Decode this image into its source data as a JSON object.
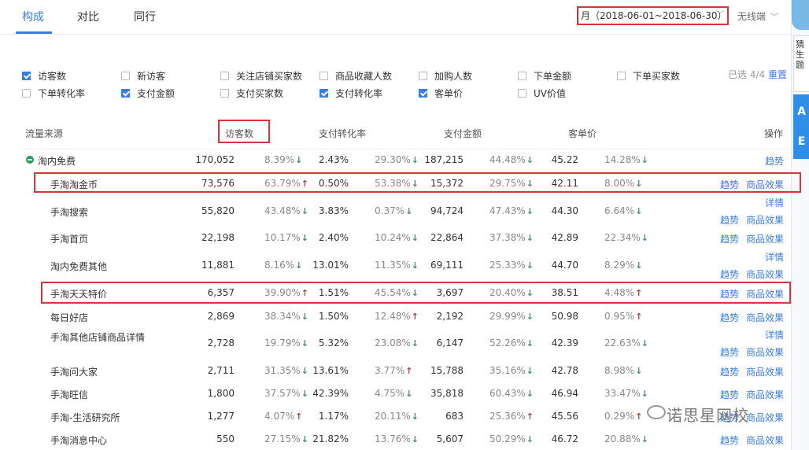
{
  "tabs": [
    {
      "label": "构成",
      "active": true
    },
    {
      "label": "对比",
      "active": false
    },
    {
      "label": "同行",
      "active": false
    }
  ],
  "date_range": "月（2018-06-01~2018-06-30）",
  "device": "无线端",
  "side_panel": {
    "tab_text": "猜生题",
    "blue1": "A",
    "blue2": "E"
  },
  "filters": [
    {
      "label": "访客数",
      "checked": true
    },
    {
      "label": "新访客",
      "checked": false
    },
    {
      "label": "关注店铺买家数",
      "checked": false
    },
    {
      "label": "商品收藏人数",
      "checked": false
    },
    {
      "label": "加购人数",
      "checked": false
    },
    {
      "label": "下单金额",
      "checked": false
    },
    {
      "label": "下单买家数",
      "checked": false
    },
    {
      "label": "下单转化率",
      "checked": false
    },
    {
      "label": "支付金额",
      "checked": true
    },
    {
      "label": "支付买家数",
      "checked": false
    },
    {
      "label": "支付转化率",
      "checked": true
    },
    {
      "label": "客单价",
      "checked": true
    },
    {
      "label": "UV价值",
      "checked": false
    }
  ],
  "selected_count": "已选 4/4",
  "reset": "重置",
  "columns": [
    "流量来源",
    "访客数",
    "支付转化率",
    "支付金额",
    "客单价",
    "操作"
  ],
  "rows": [
    {
      "source": "淘内免费",
      "top": true,
      "visitors": "170,052",
      "v_pct": "8.39%",
      "v_dir": "down",
      "conv": "2.43%",
      "c_pct": "29.30%",
      "c_dir": "down",
      "pay": "187,215",
      "p_pct": "44.48%",
      "p_dir": "down",
      "aov": "45.22",
      "a_pct": "14.28%",
      "a_dir": "down",
      "ops": [
        "趋势"
      ],
      "hl": false
    },
    {
      "source": "手淘淘金币",
      "top": false,
      "visitors": "73,576",
      "v_pct": "63.79%",
      "v_dir": "up",
      "conv": "0.50%",
      "c_pct": "53.38%",
      "c_dir": "down",
      "pay": "15,372",
      "p_pct": "29.75%",
      "p_dir": "down",
      "aov": "42.11",
      "a_pct": "8.00%",
      "a_dir": "down",
      "ops": [
        "趋势",
        "商品效果"
      ],
      "hl": true
    },
    {
      "source": "手淘搜索",
      "top": false,
      "visitors": "55,820",
      "v_pct": "43.48%",
      "v_dir": "down",
      "conv": "3.83%",
      "c_pct": "0.37%",
      "c_dir": "down",
      "pay": "94,724",
      "p_pct": "47.43%",
      "p_dir": "down",
      "aov": "44.30",
      "a_pct": "6.64%",
      "a_dir": "down",
      "ops": [
        "详情",
        "趋势",
        "商品效果"
      ],
      "hl": false
    },
    {
      "source": "手淘首页",
      "top": false,
      "visitors": "22,198",
      "v_pct": "10.17%",
      "v_dir": "down",
      "conv": "2.40%",
      "c_pct": "10.24%",
      "c_dir": "down",
      "pay": "22,864",
      "p_pct": "37.38%",
      "p_dir": "down",
      "aov": "42.89",
      "a_pct": "22.34%",
      "a_dir": "down",
      "ops": [
        "趋势",
        "商品效果"
      ],
      "hl": false
    },
    {
      "source": "淘内免费其他",
      "top": false,
      "visitors": "11,881",
      "v_pct": "8.16%",
      "v_dir": "down",
      "conv": "13.01%",
      "c_pct": "11.35%",
      "c_dir": "down",
      "pay": "69,111",
      "p_pct": "25.33%",
      "p_dir": "down",
      "aov": "44.70",
      "a_pct": "8.29%",
      "a_dir": "down",
      "ops": [
        "详情",
        "趋势",
        "商品效果"
      ],
      "hl": false
    },
    {
      "source": "手淘天天特价",
      "top": false,
      "visitors": "6,357",
      "v_pct": "39.90%",
      "v_dir": "up",
      "conv": "1.51%",
      "c_pct": "45.54%",
      "c_dir": "down",
      "pay": "3,697",
      "p_pct": "20.40%",
      "p_dir": "down",
      "aov": "38.51",
      "a_pct": "4.48%",
      "a_dir": "up",
      "ops": [
        "趋势",
        "商品效果"
      ],
      "hl": true
    },
    {
      "source": "每日好店",
      "top": false,
      "visitors": "2,869",
      "v_pct": "38.34%",
      "v_dir": "down",
      "conv": "1.50%",
      "c_pct": "12.48%",
      "c_dir": "up",
      "pay": "2,192",
      "p_pct": "29.99%",
      "p_dir": "down",
      "aov": "50.98",
      "a_pct": "0.95%",
      "a_dir": "up",
      "ops": [
        "趋势",
        "商品效果"
      ],
      "hl": false
    },
    {
      "source": "手淘其他店铺商品详情",
      "top": false,
      "visitors": "2,728",
      "v_pct": "19.79%",
      "v_dir": "down",
      "conv": "5.32%",
      "c_pct": "23.08%",
      "c_dir": "down",
      "pay": "6,147",
      "p_pct": "52.26%",
      "p_dir": "down",
      "aov": "42.39",
      "a_pct": "22.63%",
      "a_dir": "down",
      "ops": [
        "详情",
        "趋势",
        "商品效果"
      ],
      "hl": false
    },
    {
      "source": "手淘问大家",
      "top": false,
      "visitors": "2,711",
      "v_pct": "31.35%",
      "v_dir": "down",
      "conv": "13.61%",
      "c_pct": "3.77%",
      "c_dir": "up",
      "pay": "15,788",
      "p_pct": "35.16%",
      "p_dir": "down",
      "aov": "42.78",
      "a_pct": "8.98%",
      "a_dir": "down",
      "ops": [
        "趋势",
        "商品效果"
      ],
      "hl": false
    },
    {
      "source": "手淘旺信",
      "top": false,
      "visitors": "1,800",
      "v_pct": "37.57%",
      "v_dir": "down",
      "conv": "42.39%",
      "c_pct": "4.75%",
      "c_dir": "down",
      "pay": "35,818",
      "p_pct": "60.43%",
      "p_dir": "down",
      "aov": "46.94",
      "a_pct": "33.47%",
      "a_dir": "down",
      "ops": [
        "趋势",
        "商品效果"
      ],
      "hl": false
    },
    {
      "source": "手淘-生活研究所",
      "top": false,
      "visitors": "1,277",
      "v_pct": "4.07%",
      "v_dir": "up",
      "conv": "1.17%",
      "c_pct": "20.11%",
      "c_dir": "down",
      "pay": "683",
      "p_pct": "25.36%",
      "p_dir": "up",
      "aov": "45.56",
      "a_pct": "0.29%",
      "a_dir": "up",
      "ops": [
        "趋势",
        "商品效果"
      ],
      "hl": false
    },
    {
      "source": "手淘消息中心",
      "top": false,
      "visitors": "550",
      "v_pct": "27.15%",
      "v_dir": "down",
      "conv": "21.82%",
      "c_pct": "13.76%",
      "c_dir": "down",
      "pay": "5,607",
      "p_pct": "50.29%",
      "p_dir": "down",
      "aov": "46.72",
      "a_pct": "20.88%",
      "a_dir": "down",
      "ops": [
        "趋势",
        "商品效果"
      ],
      "hl": false
    }
  ],
  "watermark": "诺思星网校"
}
